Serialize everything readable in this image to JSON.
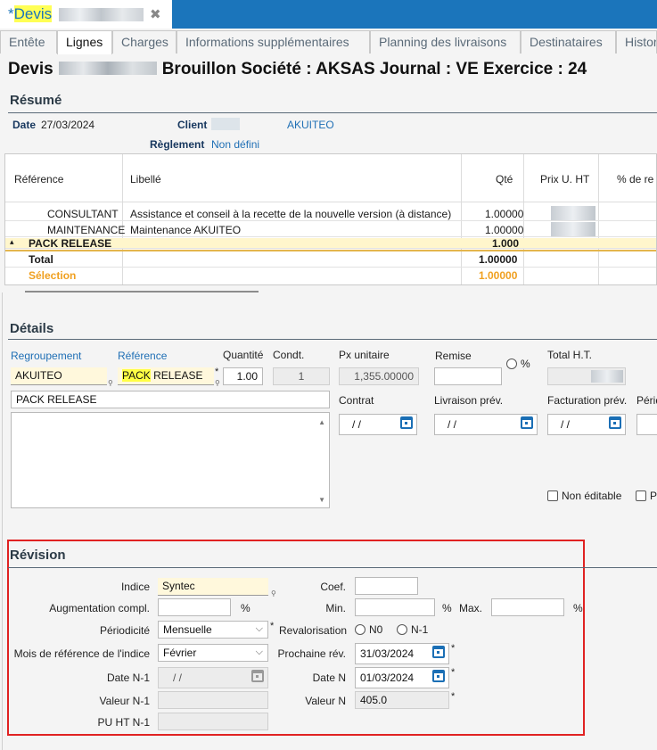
{
  "doc_tab": {
    "prefix": "*",
    "title": "Devis",
    "close": "✖"
  },
  "tabs": [
    "Entête",
    "Lignes",
    "Charges",
    "Informations supplémentaires",
    "Planning des livraisons",
    "Destinataires",
    "Histor"
  ],
  "header": {
    "devis": "Devis",
    "rest": "Brouillon  Société : AKSAS  Journal : VE  Exercice : 24"
  },
  "resume": {
    "title": "Résumé",
    "date_label": "Date",
    "date_value": "27/03/2024",
    "client_label": "Client",
    "client_name": "AKUITEO",
    "reglement_label": "Règlement",
    "reglement_value": "Non défini"
  },
  "grid": {
    "columns": [
      "Référence",
      "Libellé",
      "Qté",
      "Prix U. HT",
      "% de re"
    ],
    "rows": [
      {
        "ref": "CONSULTANT",
        "libelle": "Assistance et conseil à la recette de la nouvelle version (à distance)",
        "qte": "1.00000"
      },
      {
        "ref": "MAINTENANCE",
        "libelle": "Maintenance AKUITEO",
        "qte": "1.00000"
      },
      {
        "ref": "PACK RELEASE",
        "libelle": "",
        "qte": "1.000"
      }
    ],
    "total_label": "Total",
    "total_qte": "1.00000",
    "selection_label": "Sélection",
    "selection_qte": "1.00000"
  },
  "details": {
    "title": "Détails",
    "regroupement_label": "Regroupement",
    "regroupement_value": "AKUITEO",
    "reference_label": "Référence",
    "reference_hl": "PACK",
    "reference_rest": " RELEASE",
    "quantite_label": "Quantité",
    "quantite_value": "1.00",
    "condt_label": "Condt.",
    "condt_value": "1",
    "px_label": "Px unitaire",
    "px_value": "1,355.00000",
    "remise_label": "Remise",
    "pct": "%",
    "total_label": "Total H.T.",
    "libelle_value": "PACK RELEASE",
    "contrat_label": "Contrat",
    "livraison_label": "Livraison prév.",
    "facturation_label": "Facturation prév.",
    "periode_label": "Périd",
    "date_empty": "/  /",
    "non_editable": "Non éditable",
    "p_label": "P"
  },
  "revision": {
    "title": "Révision",
    "indice_label": "Indice",
    "indice_value": "Syntec",
    "coef_label": "Coef.",
    "augment_label": "Augmentation compl.",
    "pct": "%",
    "min_label": "Min.",
    "max_label": "Max.",
    "periodicite_label": "Périodicité",
    "periodicite_value": "Mensuelle",
    "revalorisation_label": "Revalorisation",
    "n0": "N0",
    "n1": "N-1",
    "mois_label": "Mois de référence de l'indice",
    "mois_value": "Février",
    "prochaine_label": "Prochaine rév.",
    "prochaine_value": "31/03/2024",
    "date_n1_label": "Date N-1",
    "date_n1_value": "/  /",
    "date_n_label": "Date N",
    "date_n_value": "01/03/2024",
    "valeur_n1_label": "Valeur N-1",
    "valeur_n_label": "Valeur N",
    "valeur_n_value": "405.0",
    "pu_label": "PU HT N-1",
    "star": "*"
  }
}
